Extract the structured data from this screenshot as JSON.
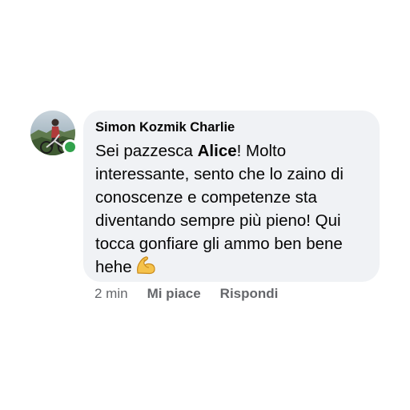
{
  "comment": {
    "author": "Simon Kozmik Charlie",
    "text_before": "Sei pazzesca ",
    "mention": "Alice",
    "text_after": "! Molto interessante, sento che lo zaino di conoscenze e competenze sta diventando sempre più pieno! Qui tocca gonfiare gli ammo ben bene hehe",
    "emoji_icon": "flexed-biceps-icon",
    "online_status_color": "#31a24c",
    "bubble_color": "#f0f2f5"
  },
  "actions": {
    "time": "2 min",
    "like_label": "Mi piace",
    "reply_label": "Rispondi"
  }
}
